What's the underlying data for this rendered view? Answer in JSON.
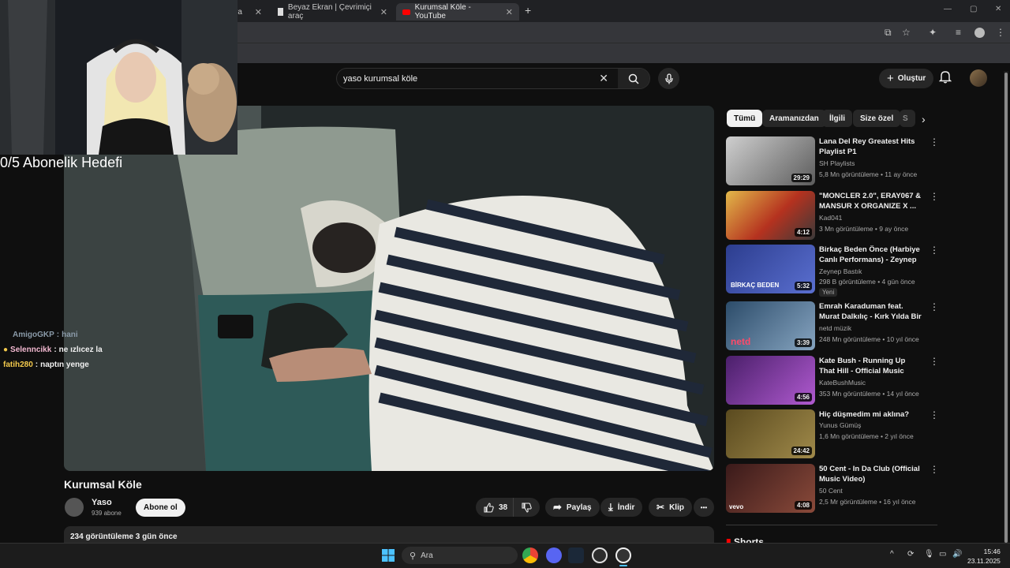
{
  "browser": {
    "tabs": [
      {
        "title": "ra",
        "active": false
      },
      {
        "title": "Beyaz Ekran | Çevrimiçi araç",
        "active": false
      },
      {
        "title": "Kurumsal Köle - YouTube",
        "active": true
      }
    ],
    "new_tab_label": "+",
    "close_glyph": "✕"
  },
  "youtube": {
    "search": {
      "value": "yaso kurumsal köle"
    },
    "create_label": "Oluştur",
    "video": {
      "title": "Kurumsal Köle",
      "channel": "Yaso",
      "subscribers": "939 abone",
      "subscribe_label": "Abone ol",
      "likes": "38",
      "share_label": "Paylaş",
      "download_label": "İndir",
      "clip_label": "Klip",
      "more_label": "•••",
      "views_date": "234 görüntüleme  3 gün önce"
    },
    "chips": [
      "Tümü",
      "Aramanızdan",
      "İlgili",
      "Size özel",
      "S"
    ],
    "recommendations": [
      {
        "title": "Lana Del Rey Greatest Hits Playlist P1",
        "channel": "SH Playlists",
        "meta": "5,8 Mn görüntüleme • 11 ay önce",
        "duration": "29:29",
        "verified": false,
        "thumb_color": "#9a9a9a"
      },
      {
        "title": "\"MONCLER 2.0\", ERAY067 & MANSUR X ORGANIZE X ...",
        "channel": "Kad041",
        "meta": "3 Mn görüntüleme • 9 ay önce",
        "duration": "4:12",
        "verified": true,
        "thumb_color": "#c23a2a"
      },
      {
        "title": "Birkaç Beden Önce (Harbiye Canlı Performans) - Zeynep ...",
        "channel": "Zeynep Bastık",
        "meta": "298 B görüntüleme • 4 gün önce",
        "duration": "5:32",
        "verified": true,
        "badge": "Yeni",
        "thumb_color": "#3a4fa8",
        "thumb_text": "BİRKAÇ BEDEN"
      },
      {
        "title": "Emrah Karaduman feat. Murat Dalkılıç - Kırk Yılda Bir Gibisin",
        "channel": "netd müzik",
        "meta": "248 Mn görüntüleme • 10 yıl önce",
        "duration": "3:39",
        "verified": true,
        "thumb_color": "#4a6a8a",
        "thumb_text": "netd"
      },
      {
        "title": "Kate Bush - Running Up That Hill - Official Music Video",
        "channel": "KateBushMusic",
        "meta": "353 Mn görüntüleme • 14 yıl önce",
        "duration": "4:56",
        "verified": true,
        "thumb_color": "#7a3aa0"
      },
      {
        "title": "Hiç düşmedim mi aklına?",
        "channel": "Yunus Gümüş",
        "meta": "1,6 Mn görüntüleme • 2 yıl önce",
        "duration": "24:42",
        "verified": true,
        "thumb_color": "#7a6a3a"
      },
      {
        "title": "50 Cent - In Da Club (Official Music Video)",
        "channel": "50 Cent",
        "meta": "2,5 Mr görüntüleme • 16 yıl önce",
        "duration": "4:08",
        "verified": true,
        "thumb_color": "#6a2a2a",
        "thumb_text": "vevo"
      }
    ],
    "shorts_label": "Shorts"
  },
  "overlay": {
    "goal": "0/5 Abonelik Hedefi",
    "chat": [
      {
        "user": "AmigoGKP",
        "message": "hani",
        "color": "#8a9aa8"
      },
      {
        "user": "Selenncikk",
        "message": "ne ızlıcez la",
        "color": "#f2b8d0"
      },
      {
        "user": "fatih280",
        "message": "naptın yenge",
        "color": "#f2c94c"
      }
    ]
  },
  "taskbar": {
    "search_label": "Ara",
    "time": "15:46",
    "date": "23.11.2025"
  },
  "colors": {
    "accent_red": "#ff0000",
    "bg": "#0f0f0f",
    "pill": "#272727"
  }
}
